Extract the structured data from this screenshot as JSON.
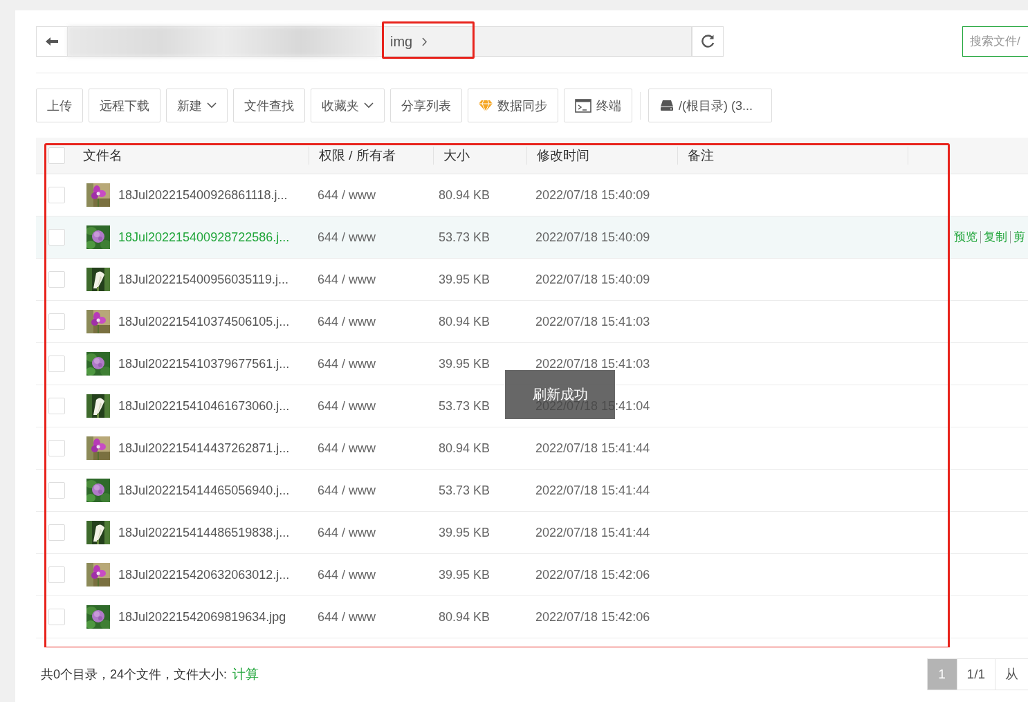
{
  "path_bar": {
    "current": "img",
    "highlighted": true
  },
  "search": {
    "placeholder": "搜索文件/"
  },
  "toolbar": [
    {
      "label": "上传",
      "kind": "plain"
    },
    {
      "label": "远程下载",
      "kind": "plain"
    },
    {
      "label": "新建",
      "kind": "dropdown"
    },
    {
      "label": "文件查找",
      "kind": "plain"
    },
    {
      "label": "收藏夹",
      "kind": "dropdown"
    },
    {
      "label": "分享列表",
      "kind": "plain"
    },
    {
      "label": "数据同步",
      "kind": "gem"
    },
    {
      "label": "终端",
      "kind": "terminal"
    },
    {
      "label": "/(根目录) (3...",
      "kind": "drive"
    }
  ],
  "table": {
    "highlighted": true,
    "all_checked": false,
    "columns": [
      "文件名",
      "权限 / 所有者",
      "大小",
      "修改时间",
      "备注"
    ],
    "rows": [
      {
        "name": "18Jul202215400926861118.j...",
        "perms": "644 / www",
        "size": "80.94 KB",
        "modified": "2022/07/18 15:40:09",
        "checked": false,
        "hovered": false
      },
      {
        "name": "18Jul202215400928722586.j...",
        "perms": "644 / www",
        "size": "53.73 KB",
        "modified": "2022/07/18 15:40:09",
        "checked": false,
        "hovered": true,
        "actions": [
          "预览",
          "复制",
          "剪"
        ]
      },
      {
        "name": "18Jul202215400956035119.j...",
        "perms": "644 / www",
        "size": "39.95 KB",
        "modified": "2022/07/18 15:40:09",
        "checked": false,
        "hovered": false
      },
      {
        "name": "18Jul202215410374506105.j...",
        "perms": "644 / www",
        "size": "80.94 KB",
        "modified": "2022/07/18 15:41:03",
        "checked": false,
        "hovered": false
      },
      {
        "name": "18Jul202215410379677561.j...",
        "perms": "644 / www",
        "size": "39.95 KB",
        "modified": "2022/07/18 15:41:03",
        "checked": false,
        "hovered": false
      },
      {
        "name": "18Jul202215410461673060.j...",
        "perms": "644 / www",
        "size": "53.73 KB",
        "modified": "2022/07/18 15:41:04",
        "checked": false,
        "hovered": false
      },
      {
        "name": "18Jul202215414437262871.j...",
        "perms": "644 / www",
        "size": "80.94 KB",
        "modified": "2022/07/18 15:41:44",
        "checked": false,
        "hovered": false
      },
      {
        "name": "18Jul202215414465056940.j...",
        "perms": "644 / www",
        "size": "53.73 KB",
        "modified": "2022/07/18 15:41:44",
        "checked": false,
        "hovered": false
      },
      {
        "name": "18Jul202215414486519838.j...",
        "perms": "644 / www",
        "size": "39.95 KB",
        "modified": "2022/07/18 15:41:44",
        "checked": false,
        "hovered": false
      },
      {
        "name": "18Jul202215420632063012.j...",
        "perms": "644 / www",
        "size": "39.95 KB",
        "modified": "2022/07/18 15:42:06",
        "checked": false,
        "hovered": false
      },
      {
        "name": "18Jul20221542069819634.jpg",
        "perms": "644 / www",
        "size": "80.94 KB",
        "modified": "2022/07/18 15:42:06",
        "checked": false,
        "hovered": false
      }
    ]
  },
  "toast": "刷新成功",
  "footer": {
    "summary": "共0个目录，24个文件，文件大小:",
    "link": "计算"
  },
  "pagination": [
    {
      "label": "1",
      "selected": true
    },
    {
      "label": "1/1",
      "selected": false
    },
    {
      "label": "从",
      "selected": false
    }
  ]
}
